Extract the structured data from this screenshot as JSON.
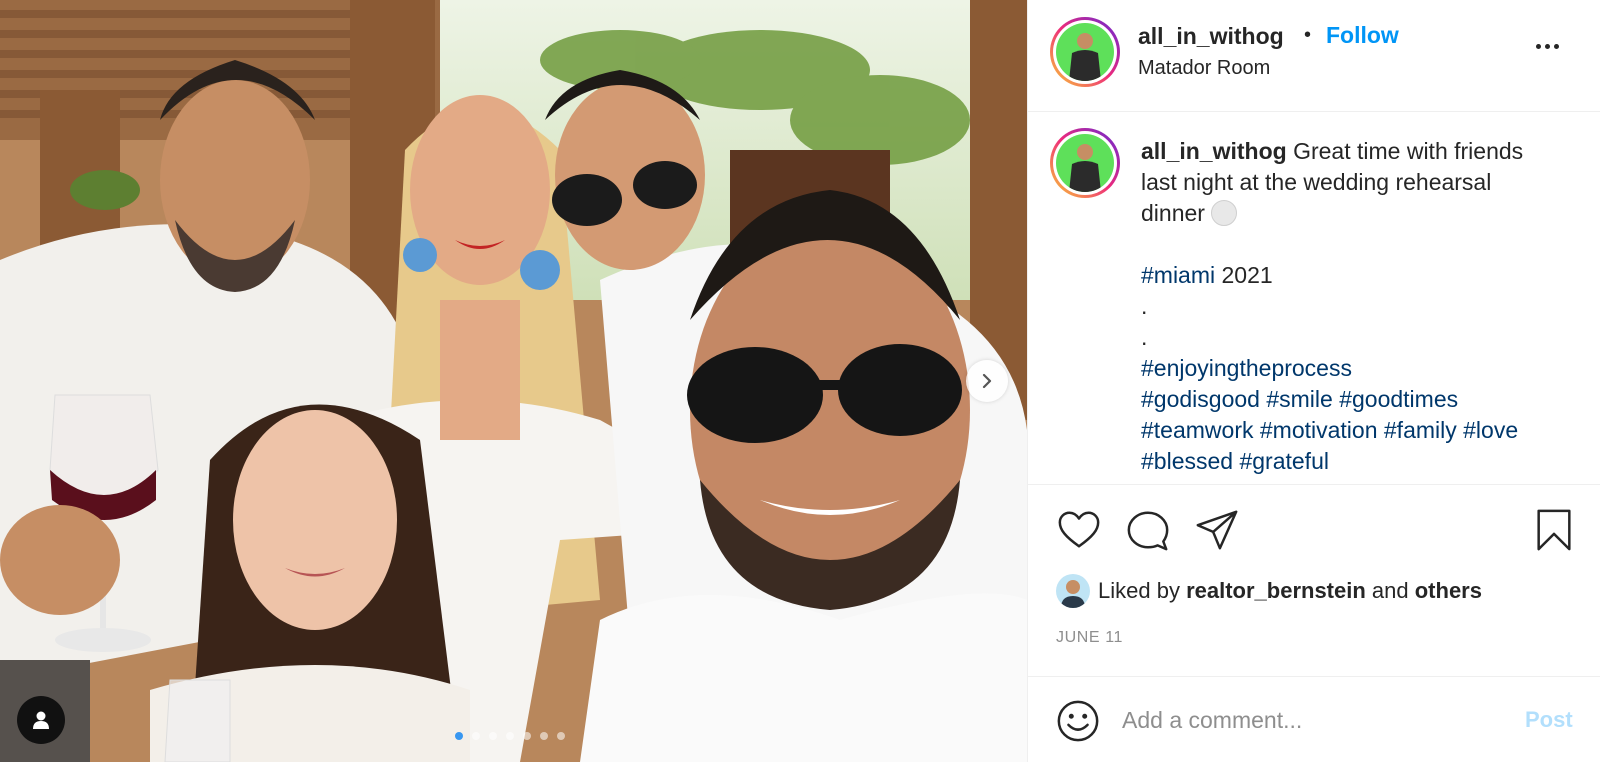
{
  "post": {
    "username": "all_in_withog",
    "separator": "•",
    "follow_label": "Follow",
    "location": "Matador Room",
    "more_icon": "more-options-icon"
  },
  "caption": {
    "username": "all_in_withog",
    "line1": "Great time with friends",
    "line2": "last night at the wedding rehearsal",
    "line3": "dinner",
    "line4_tag": "#miami",
    "line4_text": " 2021",
    "dot1": ".",
    "dot2": ".",
    "tags_line1": [
      "#enjoyingtheprocess"
    ],
    "tags_line2": [
      "#godisgood",
      "#smile",
      "#goodtimes"
    ],
    "tags_line3": [
      "#teamwork",
      "#motivation",
      "#family",
      "#love"
    ],
    "tags_line4": [
      "#blessed",
      "#grateful"
    ]
  },
  "media": {
    "carousel_count": 7,
    "carousel_active_index": 0,
    "accent": "#3897f0"
  },
  "likes": {
    "prefix": "Liked by ",
    "user": "realtor_bernstein",
    "and": " and ",
    "others": "others"
  },
  "date": "JUNE 11",
  "comment": {
    "placeholder": "Add a comment...",
    "post_label": "Post"
  },
  "colors": {
    "follow": "#0095f6",
    "hashtag": "#00376b",
    "post_disabled": "#b2dffc",
    "avatar_bg": "#5ee05a"
  }
}
